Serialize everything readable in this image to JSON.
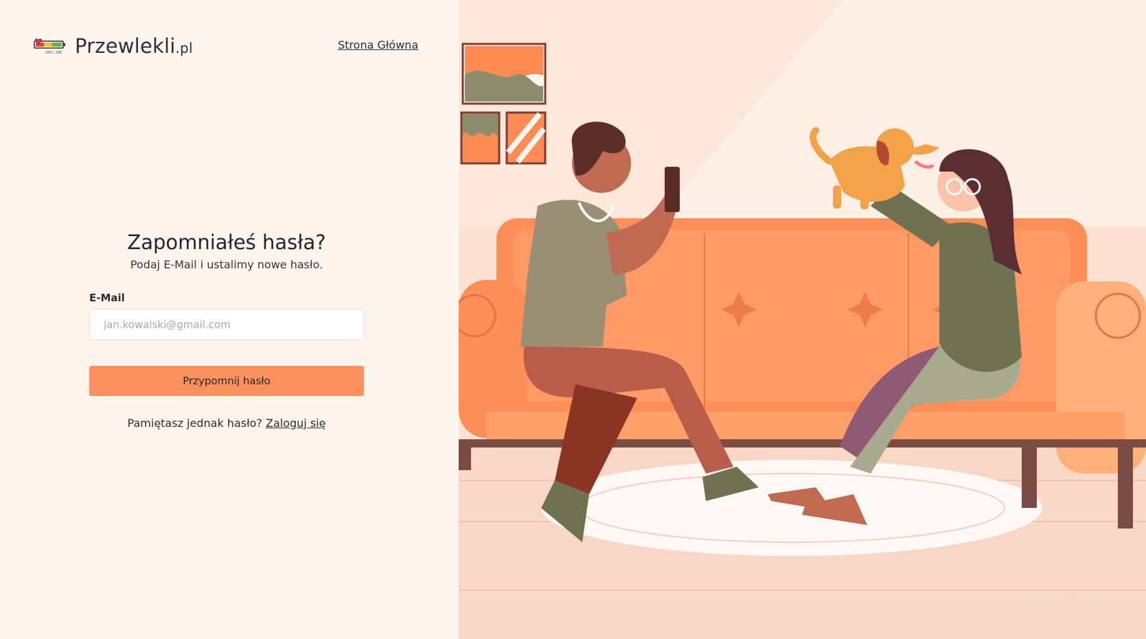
{
  "brand": {
    "name": "Przewlekli",
    "tld": ".pl",
    "badge_text": "100 / 100"
  },
  "nav": {
    "home_label": "Strona Główna"
  },
  "form": {
    "title": "Zapomniałeś hasła?",
    "subtitle": "Podaj E-Mail i ustalimy nowe hasło.",
    "email_label": "E-Mail",
    "email_placeholder": "jan.kowalski@gmail.com",
    "email_value": "",
    "submit_label": "Przypomnij hasło",
    "remember_text": "Pamiętasz jednak hasło?",
    "login_link": "Zaloguj się"
  },
  "illustration": {
    "credit": "Ilustracja z Freepik"
  },
  "colors": {
    "accent": "#fd9260",
    "background_left": "#fef5ee",
    "background_right": "#fde7da",
    "sofa": "#fe8f58",
    "olive": "#6f7150"
  }
}
